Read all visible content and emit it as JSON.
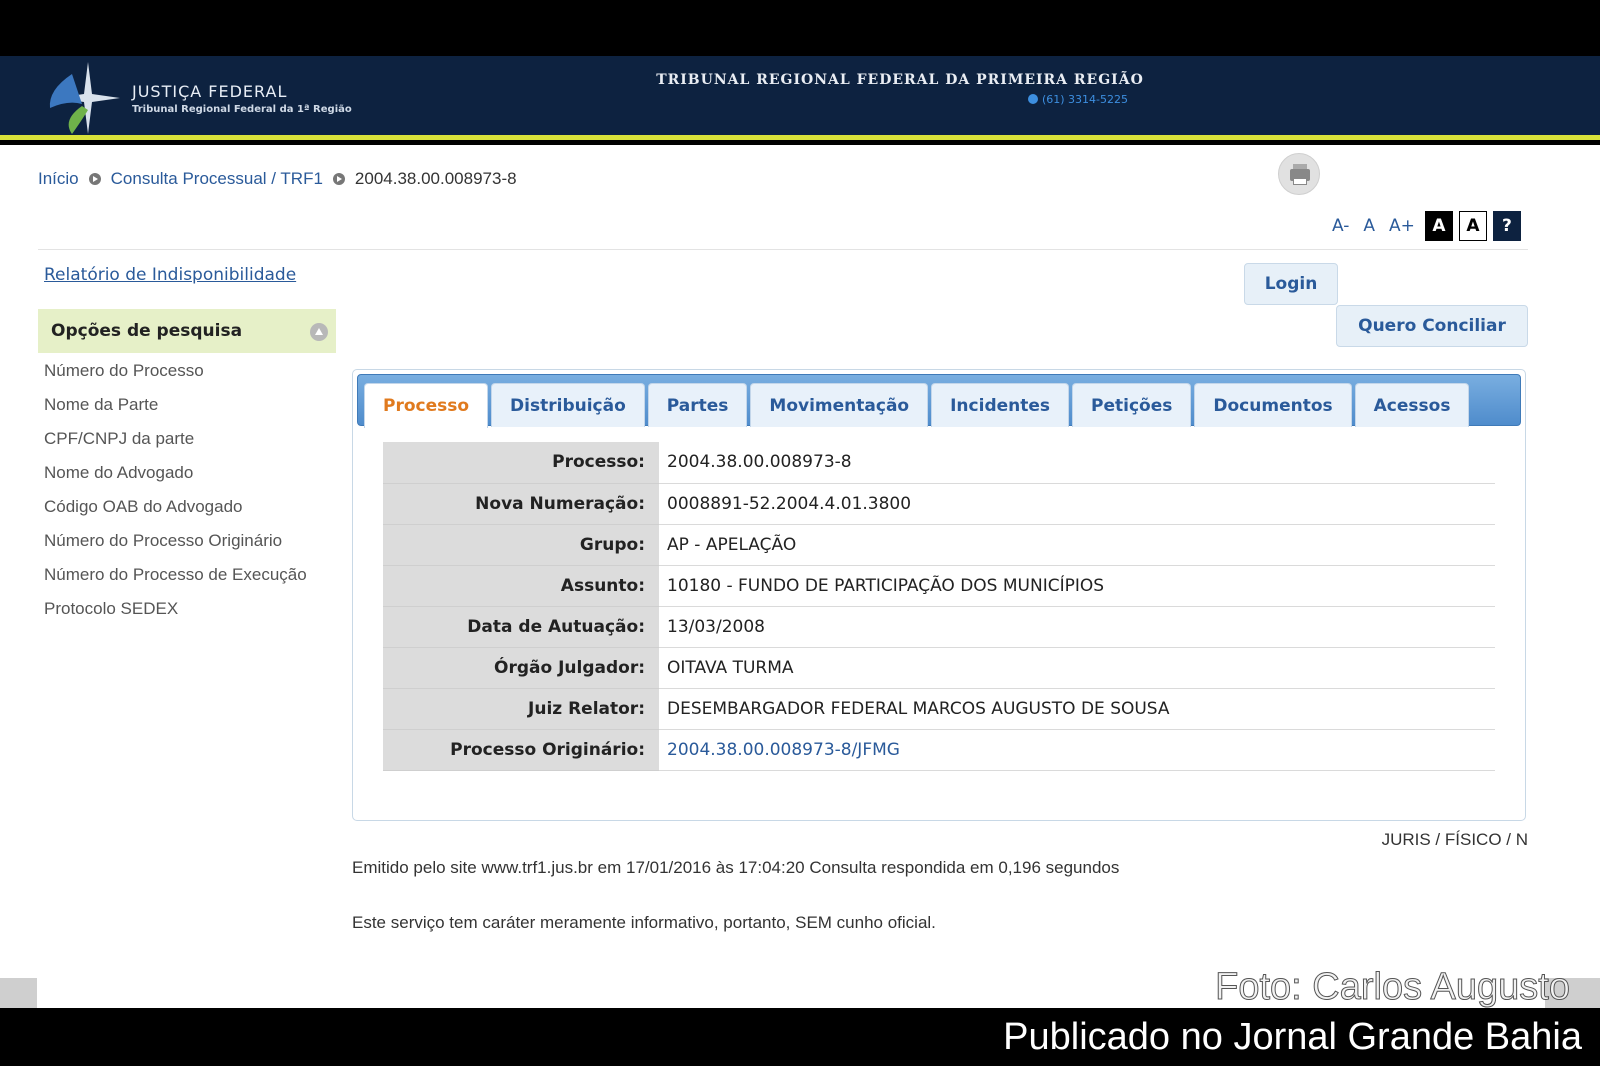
{
  "header": {
    "logo_title": "JUSTIÇA FEDERAL",
    "logo_subtitle": "Tribunal Regional Federal da 1ª Região",
    "court_title": "TRIBUNAL REGIONAL FEDERAL DA PRIMEIRA REGIÃO",
    "phone": "(61) 3314-5225"
  },
  "breadcrumb": {
    "home": "Início",
    "section": "Consulta Processual / TRF1",
    "current": "2004.38.00.008973-8"
  },
  "font_tools": {
    "decrease": "A-",
    "normal": "A",
    "increase": "A+",
    "contrast_dark": "A",
    "contrast_light": "A",
    "help": "?"
  },
  "sidebar": {
    "report_link": "Relatório de Indisponibilidade",
    "options_title": "Opções de pesquisa",
    "items": [
      "Número do Processo",
      "Nome da Parte",
      "CPF/CNPJ da parte",
      "Nome do Advogado",
      "Código OAB do Advogado",
      "Número do Processo Originário",
      "Número do Processo de Execução",
      "Protocolo SEDEX"
    ]
  },
  "actions": {
    "login": "Login",
    "conciliar": "Quero Conciliar"
  },
  "tabs": [
    "Processo",
    "Distribuição",
    "Partes",
    "Movimentação",
    "Incidentes",
    "Petições",
    "Documentos",
    "Acessos"
  ],
  "active_tab": "Processo",
  "process": [
    {
      "label": "Processo:",
      "value": "2004.38.00.008973-8"
    },
    {
      "label": "Nova Numeração:",
      "value": "0008891-52.2004.4.01.3800"
    },
    {
      "label": "Grupo:",
      "value": "AP - APELAÇÃO"
    },
    {
      "label": "Assunto:",
      "value": "10180 - FUNDO DE PARTICIPAÇÃO DOS MUNICÍPIOS"
    },
    {
      "label": "Data de Autuação:",
      "value": "13/03/2008"
    },
    {
      "label": "Órgão Julgador:",
      "value": "OITAVA TURMA"
    },
    {
      "label": "Juiz Relator:",
      "value": "DESEMBARGADOR FEDERAL MARCOS AUGUSTO DE SOUSA"
    },
    {
      "label": "Processo Originário:",
      "value": "2004.38.00.008973-8/JFMG"
    }
  ],
  "footer": {
    "juris": "JURIS / FÍSICO / N",
    "emitido": "Emitido pelo site www.trf1.jus.br em 17/01/2016 às 17:04:20 Consulta respondida em 0,196 segundos",
    "servico": "Este serviço tem caráter meramente informativo, portanto, SEM cunho oficial."
  },
  "overlay": {
    "foto": "Foto: Carlos Augusto",
    "publicado": "Publicado no Jornal Grande Bahia"
  },
  "colors": {
    "header_bg": "#0d2240",
    "header_accent": "#d8e23a",
    "link": "#2a5a9a",
    "active_tab": "#e07a1e",
    "options_bg": "#e6f0c8"
  },
  "icons": [
    "justica-federal-logo",
    "phone-icon",
    "breadcrumb-separator-icon",
    "print-icon",
    "collapse-icon"
  ]
}
